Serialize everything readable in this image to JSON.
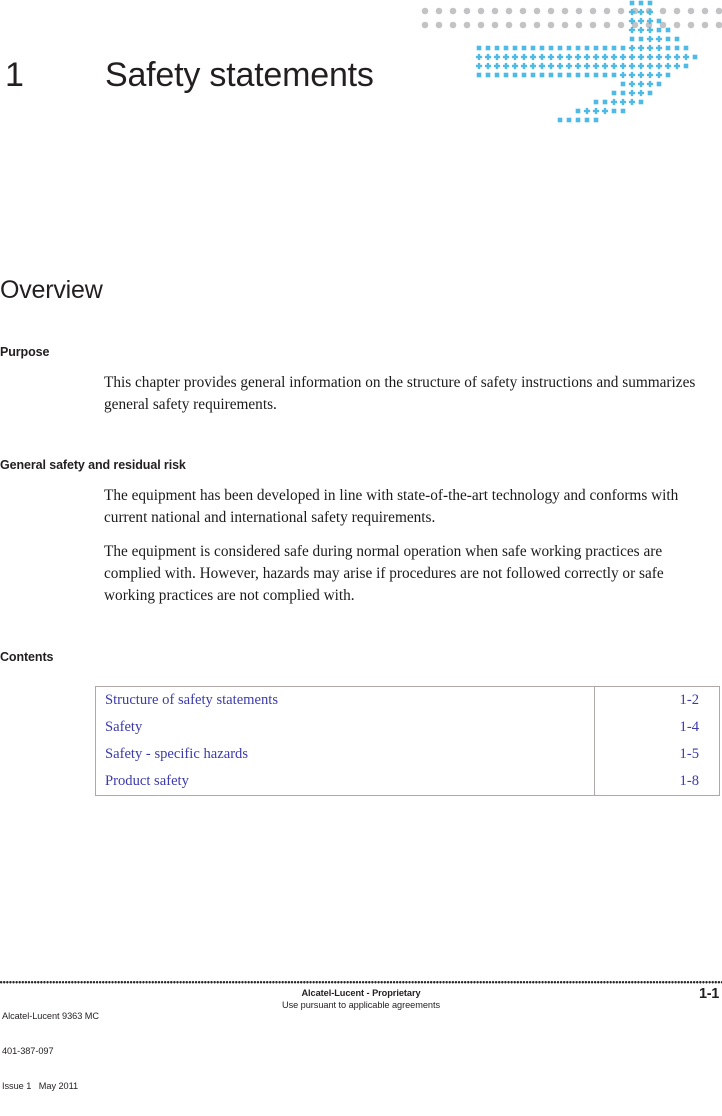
{
  "document": {
    "chapter_number": "1",
    "chapter_title": "Safety statements"
  },
  "colors": {
    "logo_blue": "#4fbae6",
    "logo_gray": "#c3c3c5",
    "link_blue": "#3b3bab",
    "text_black": "#231f20",
    "table_border": "#b0a8a8"
  },
  "sections": {
    "overview": {
      "heading": "Overview"
    },
    "purpose": {
      "heading": "Purpose",
      "paragraphs": [
        "This chapter provides general information on the structure of safety instructions and summarizes general safety requirements."
      ]
    },
    "general_safety": {
      "heading": "General safety and residual risk",
      "paragraphs": [
        "The equipment has been developed in line with state-of-the-art technology and conforms with current national and international safety requirements.",
        "The equipment is considered safe during normal operation when safe working practices are complied with. However, hazards may arise if procedures are not followed correctly or safe working practices are not complied with."
      ]
    },
    "contents": {
      "heading": "Contents",
      "rows": [
        {
          "label": "Structure of safety statements",
          "page": "1-2"
        },
        {
          "label": "Safety",
          "page": "1-4"
        },
        {
          "label": "Safety - specific hazards",
          "page": "1-5"
        },
        {
          "label": "Product safety",
          "page": "1-8"
        }
      ]
    }
  },
  "footer": {
    "left_line1": "Alcatel-Lucent 9363 MC",
    "left_line2": "401-387-097",
    "left_line3": "Issue 1   May 2011",
    "center_line1": "Alcatel-Lucent - Proprietary",
    "center_line2": "Use pursuant to applicable agreements",
    "page_number": "1-1"
  }
}
